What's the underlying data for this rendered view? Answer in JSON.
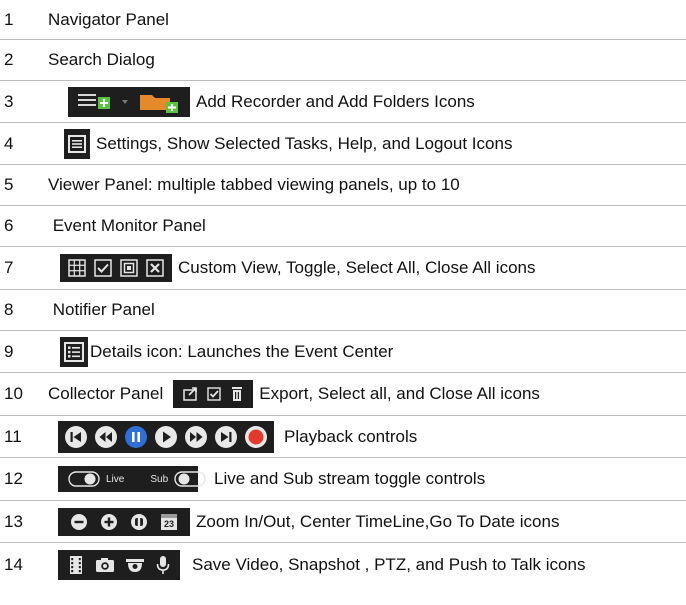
{
  "rows": [
    {
      "num": "1",
      "text": "Navigator Panel"
    },
    {
      "num": "2",
      "text": "Search Dialog"
    },
    {
      "num": "3",
      "text": "Add Recorder and Add Folders Icons"
    },
    {
      "num": "4",
      "text": "Settings, Show Selected Tasks, Help, and Logout Icons"
    },
    {
      "num": "5",
      "text": "Viewer Panel: multiple tabbed viewing panels, up to 10"
    },
    {
      "num": "6",
      "text": " Event Monitor Panel"
    },
    {
      "num": "7",
      "text": "Custom View, Toggle, Select All, Close All icons"
    },
    {
      "num": "8",
      "text": " Notifier Panel"
    },
    {
      "num": "9",
      "text": "Details icon: Launches the Event Center"
    },
    {
      "num": "10",
      "text": "Collector Panel",
      "text2": "Export, Select all, and Close All icons"
    },
    {
      "num": "11",
      "text": "Playback controls"
    },
    {
      "num": "12",
      "text": "Live and Sub stream toggle controls",
      "toggle_live": "Live",
      "toggle_sub": "Sub"
    },
    {
      "num": "13",
      "text": "Zoom In/Out, Center TimeLine,Go To Date icons",
      "calendar_day": "23"
    },
    {
      "num": "14",
      "text": "Save Video, Snapshot , PTZ, and Push to Talk icons"
    }
  ],
  "colors": {
    "icon_bg": "#1e1e1e",
    "accent_green": "#5cc242",
    "folder_orange": "#e58a2b",
    "playback_blue": "#2f6fd6",
    "record_red": "#e23b2e"
  }
}
